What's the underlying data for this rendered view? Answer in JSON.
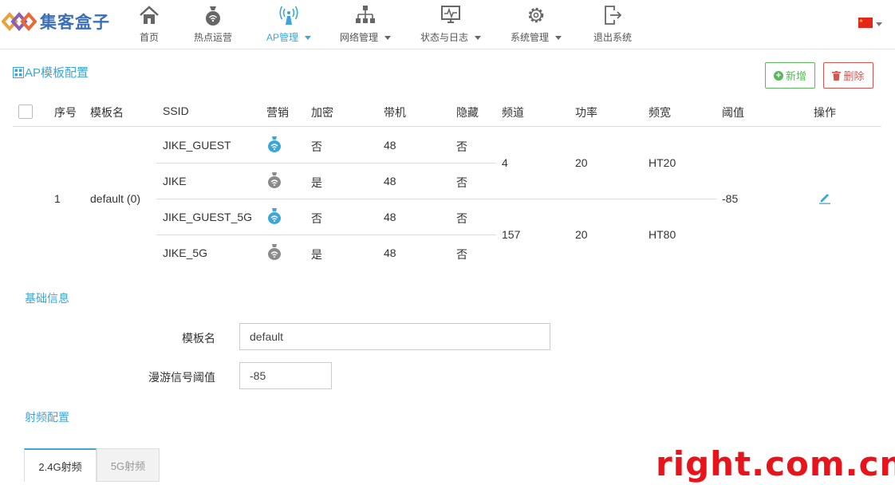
{
  "brand": {
    "name": "集客盒子"
  },
  "nav": [
    {
      "label": "首页",
      "icon": "home-icon"
    },
    {
      "label": "热点运营",
      "icon": "money-bag-icon"
    },
    {
      "label": "AP管理",
      "icon": "wifi-ap-icon",
      "active": true
    },
    {
      "label": "网络管理",
      "icon": "network-tree-icon"
    },
    {
      "label": "状态与日志",
      "icon": "monitor-pulse-icon"
    },
    {
      "label": "系统管理",
      "icon": "gear-icon"
    },
    {
      "label": "退出系统",
      "icon": "logout-icon"
    }
  ],
  "page": {
    "title": "AP模板配置",
    "add_label": "新增",
    "delete_label": "删除"
  },
  "table": {
    "headers": [
      "序号",
      "模板名",
      "SSID",
      "营销",
      "加密",
      "带机",
      "隐藏",
      "频道",
      "功率",
      "频宽",
      "阈值",
      "操作"
    ],
    "row": {
      "index": "1",
      "name": "default (0)",
      "threshold": "-85",
      "ssids": [
        {
          "ssid": "JIKE_GUEST",
          "marketing": true,
          "encrypt": "否",
          "clients": "48",
          "hidden": "否"
        },
        {
          "ssid": "JIKE",
          "marketing": false,
          "encrypt": "是",
          "clients": "48",
          "hidden": "否"
        },
        {
          "ssid": "JIKE_GUEST_5G",
          "marketing": true,
          "encrypt": "否",
          "clients": "48",
          "hidden": "否"
        },
        {
          "ssid": "JIKE_5G",
          "marketing": false,
          "encrypt": "是",
          "clients": "48",
          "hidden": "否"
        }
      ],
      "radios": [
        {
          "channel": "4",
          "power": "20",
          "bandwidth": "HT20"
        },
        {
          "channel": "157",
          "power": "20",
          "bandwidth": "HT80"
        }
      ]
    }
  },
  "basic": {
    "title": "基础信息",
    "template_name_label": "模板名",
    "template_name_value": "default",
    "roam_label": "漫游信号阈值",
    "roam_value": "-85"
  },
  "rf": {
    "title": "射频配置",
    "tabs": [
      "2.4G射频",
      "5G射频"
    ]
  },
  "watermark": "right.com.cn",
  "colors": {
    "accent": "#3da6d8",
    "add": "#5cb85c",
    "delete": "#d9534f",
    "bag_active": "#3da6d8",
    "bag_inactive": "#8a8a8a"
  }
}
